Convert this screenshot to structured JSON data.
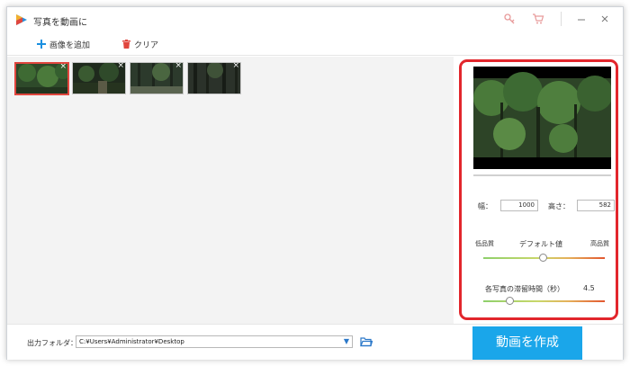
{
  "app": {
    "title": "写真を動画に"
  },
  "toolbar": {
    "add_label": "画像を追加",
    "clear_label": "クリア"
  },
  "thumbnails": [
    {
      "selected": true
    },
    {
      "selected": false
    },
    {
      "selected": false
    },
    {
      "selected": false
    }
  ],
  "panel": {
    "width_label": "幅：",
    "width_value": "1000",
    "height_label": "高さ：",
    "height_value": "582",
    "quality_low": "低品質",
    "quality_default": "デフォルト値",
    "quality_high": "高品質",
    "quality_level": 0.49,
    "duration_label": "各写真の滞留時間（秒）",
    "duration_value": "4.5",
    "duration_level": 0.22
  },
  "bottom": {
    "output_label": "出力フォルダ：",
    "output_path": "C:¥Users¥Administrator¥Desktop",
    "create_label": "動画を作成"
  },
  "colors": {
    "accent": "#1aa6ea",
    "highlight": "#e2262c"
  }
}
